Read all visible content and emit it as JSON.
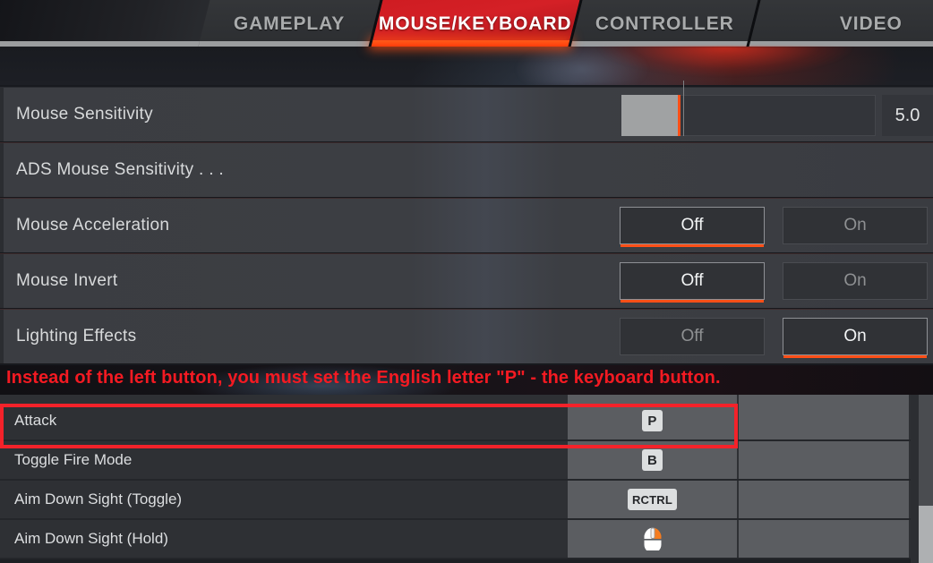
{
  "header": {
    "tabs": [
      {
        "label": "GAMEPLAY",
        "active": false
      },
      {
        "label": "MOUSE/KEYBOARD",
        "active": true
      },
      {
        "label": "CONTROLLER",
        "active": false
      },
      {
        "label": "VIDEO",
        "active": false
      }
    ]
  },
  "colors": {
    "accent_orange": "#ff4f17",
    "tab_red": "#d42026",
    "annotation_red": "#f41a22",
    "highlight_red": "#f4222a",
    "row_bg": "#3c3e43",
    "bind_bg": "#5b5d61",
    "keycap_bg": "#dcdedf",
    "slider_fill": "#a0a2a3",
    "scrollbar_thumb": "#aeb0b2"
  },
  "settings": {
    "rows": [
      {
        "label": "Mouse Sensitivity",
        "control": "slider",
        "value": "5.0",
        "fill_percent": 23
      },
      {
        "label": "ADS Mouse Sensitivity . . .",
        "control": "submenu"
      },
      {
        "label": "Mouse Acceleration",
        "control": "toggle",
        "options": [
          {
            "label": "Off",
            "selected": true
          },
          {
            "label": "On",
            "selected": false
          }
        ]
      },
      {
        "label": "Mouse Invert",
        "control": "toggle",
        "options": [
          {
            "label": "Off",
            "selected": true
          },
          {
            "label": "On",
            "selected": false
          }
        ]
      },
      {
        "label": "Lighting Effects",
        "control": "toggle",
        "options": [
          {
            "label": "Off",
            "selected": false
          },
          {
            "label": "On",
            "selected": true
          }
        ]
      }
    ]
  },
  "annotation": {
    "text": "Instead of the left button, you must set the English letter \"P\" - the keyboard button.",
    "highlighted_row": "Attack"
  },
  "keybinds": {
    "rows": [
      {
        "label": "Attack",
        "primary": "P",
        "primary_type": "key",
        "secondary": "",
        "highlighted": true
      },
      {
        "label": "Toggle Fire Mode",
        "primary": "B",
        "primary_type": "key",
        "secondary": "",
        "highlighted": false
      },
      {
        "label": "Aim Down Sight (Toggle)",
        "primary": "RCTRL",
        "primary_type": "key",
        "secondary": "",
        "highlighted": false
      },
      {
        "label": "Aim Down Sight (Hold)",
        "primary": "mouse-right-button-icon",
        "primary_type": "icon",
        "secondary": "",
        "highlighted": false
      }
    ]
  },
  "scrollbar": {
    "thumb_position_percent": 66
  }
}
